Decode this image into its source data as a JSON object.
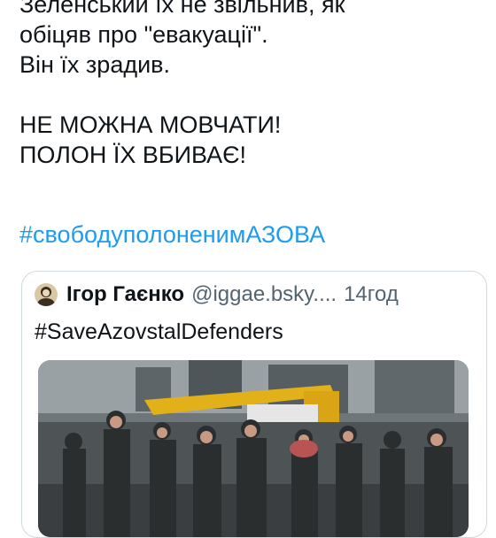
{
  "post": {
    "lines": [
      "Зеленський їх не звільнив, як",
      "обіцяв про \"евакуації\".",
      "Він їх зрадив.",
      "НЕ МОЖНА МОВЧАТИ!",
      "ПОЛОН ЇХ ВБИВАЄ!"
    ],
    "hashtag": "#свободуполоненимАЗОВА"
  },
  "quote": {
    "author_name": "Ігор Гаєнко",
    "author_handle": "@iggae.bsky....",
    "time": "14год",
    "text": "#SaveAzovstalDefenders",
    "avatar_icon": "portrait-avatar",
    "media_icon": "photo-soldiers-crane"
  },
  "colors": {
    "link": "#1d9bf0",
    "text": "#0f1419",
    "secondary": "#536471",
    "border": "#cfd9de"
  }
}
